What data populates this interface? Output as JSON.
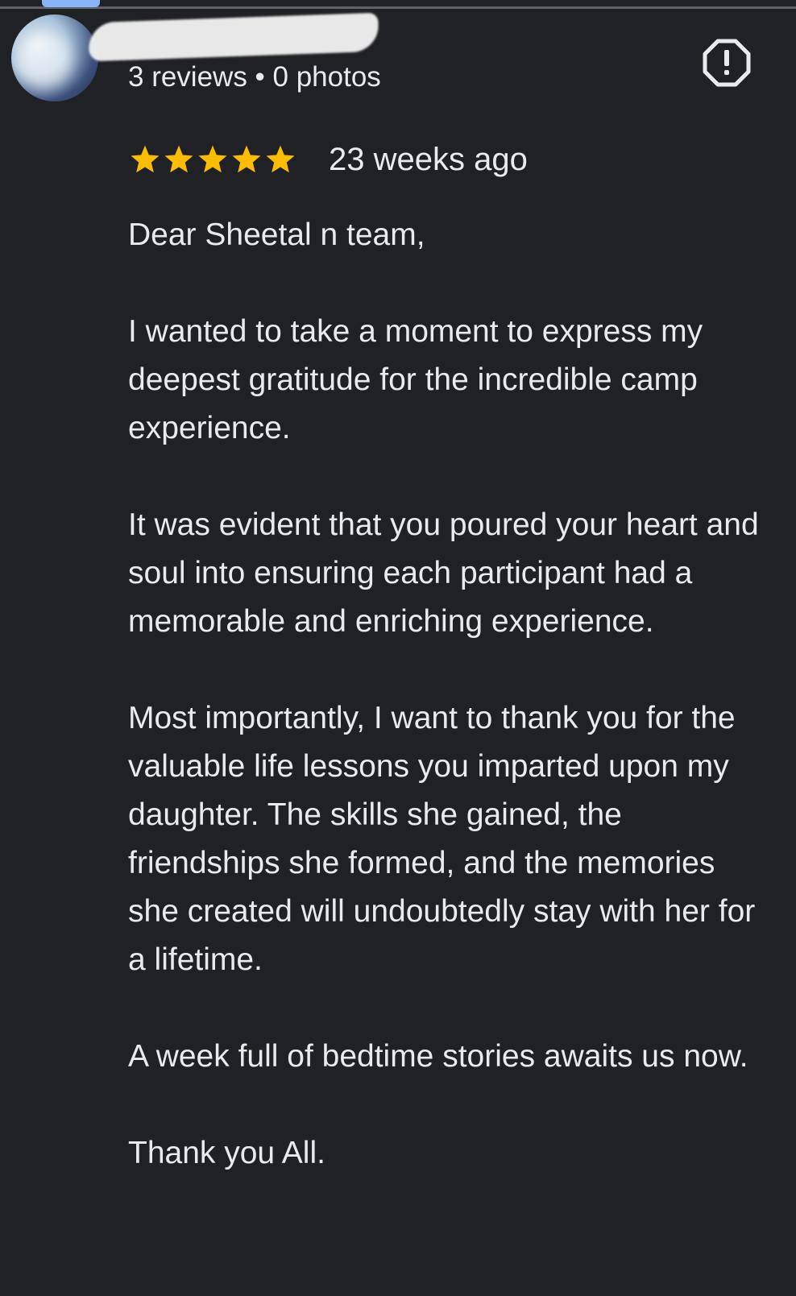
{
  "reviewer": {
    "name": "",
    "meta": "3 reviews • 0 photos"
  },
  "icons": {
    "report": "report-flag-icon",
    "star": "star-icon"
  },
  "review": {
    "rating": 5,
    "rating_max": 5,
    "time": "23 weeks ago",
    "paragraphs": [
      "Dear Sheetal n team,",
      "I wanted to take a moment to express my deepest gratitude for the incredible camp experience.",
      "It was evident that you poured your heart and soul into ensuring each participant had a memorable and enriching experience.",
      "Most importantly, I want to thank you for the valuable life lessons you imparted upon my daughter. The skills she gained, the friendships she formed, and the memories she created will undoubtedly stay with her for a lifetime.",
      "A week full of bedtime stories awaits us now.",
      "Thank you All."
    ]
  },
  "colors": {
    "background": "#202124",
    "text": "#e8eaed",
    "star": "#fbbc04",
    "icon": "#e8eaed"
  }
}
